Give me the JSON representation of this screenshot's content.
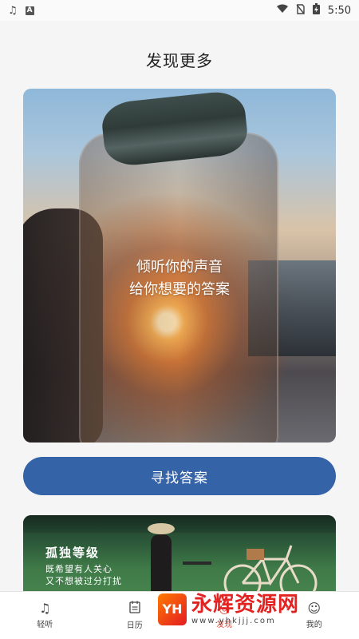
{
  "status_bar": {
    "left_icons": [
      "music-note-icon",
      "text-a-icon"
    ],
    "right_icons": [
      "wifi-icon",
      "no-sim-icon",
      "battery-charging-icon"
    ],
    "time": "5:50"
  },
  "header": {
    "title": "发现更多"
  },
  "hero": {
    "line1": "倾听你的声音",
    "line2": "给你想要的答案"
  },
  "find_button": {
    "label": "寻找答案"
  },
  "article_card": {
    "title": "孤独等级",
    "subtitle_line1": "既希望有人关心",
    "subtitle_line2": "又不想被过分打扰"
  },
  "bottom_nav": {
    "items": [
      {
        "label": "轻听",
        "icon": "music-list-icon"
      },
      {
        "label": "日历",
        "icon": "calendar-icon"
      },
      {
        "label": "发现",
        "icon": "discover-icon"
      },
      {
        "label": "我的",
        "icon": "profile-icon"
      }
    ]
  },
  "watermark": {
    "logo_text": "YH",
    "name": "永辉资源网",
    "url": "www.yhkjjj.com"
  },
  "colors": {
    "primary": "#3563a8",
    "active_nav": "#d64b3a",
    "background": "#f5f5f5"
  }
}
